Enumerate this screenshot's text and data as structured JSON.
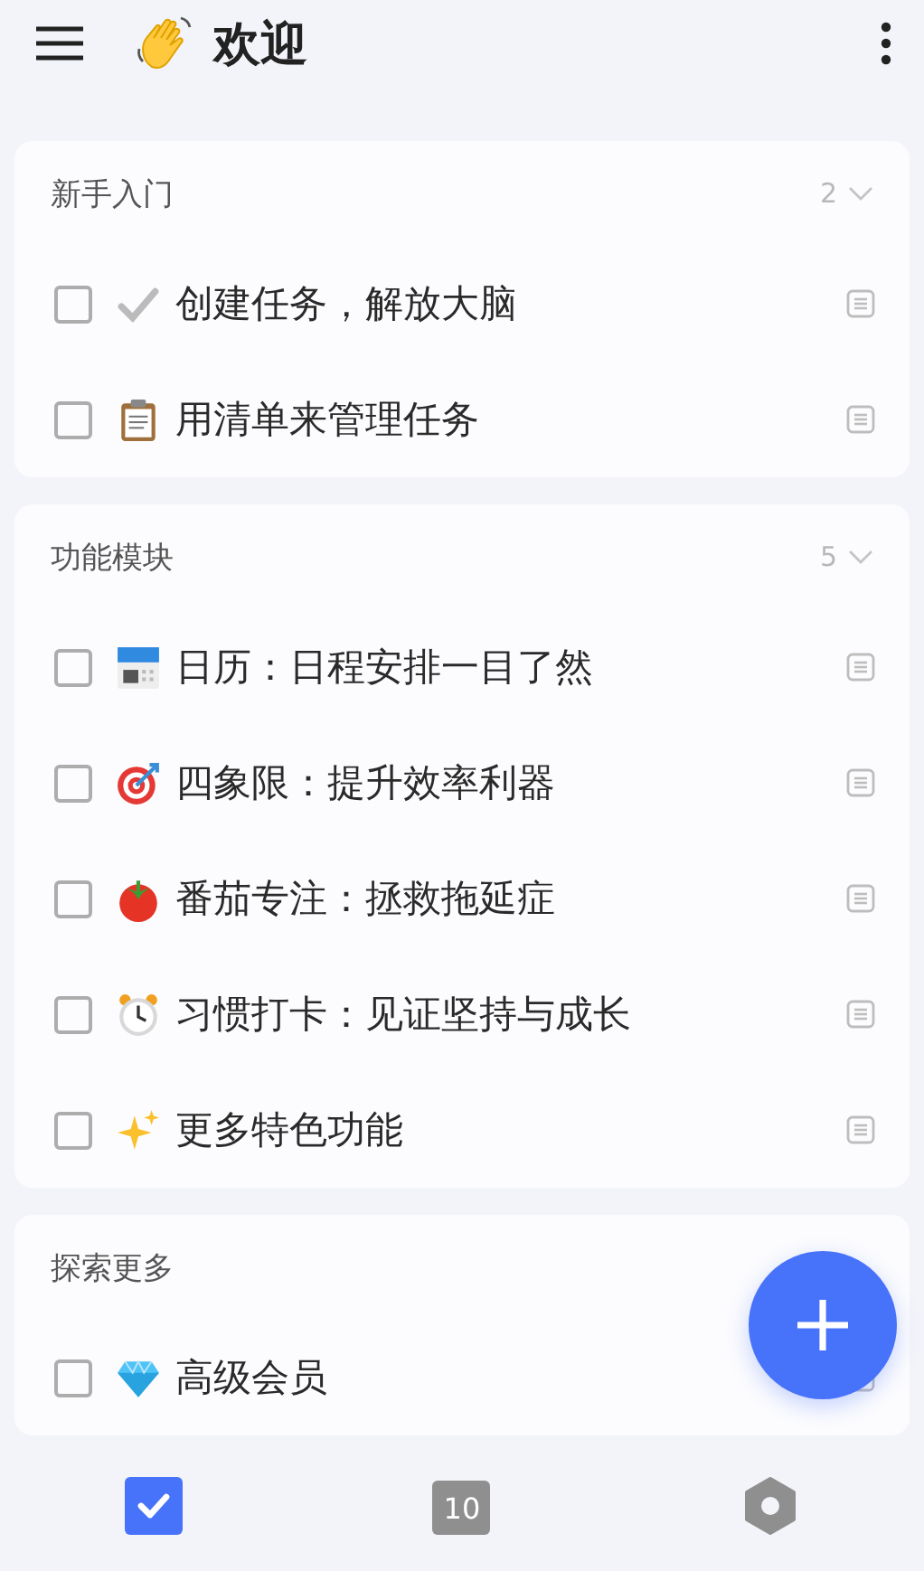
{
  "header": {
    "title": "欢迎"
  },
  "sections": [
    {
      "title": "新手入门",
      "count": "2",
      "expanded": true,
      "tasks": [
        {
          "title": "创建任务，解放大脑",
          "checked": false
        },
        {
          "title": "用清单来管理任务",
          "checked": false
        }
      ]
    },
    {
      "title": "功能模块",
      "count": "5",
      "expanded": true,
      "tasks": [
        {
          "title": "日历：日程安排一目了然",
          "checked": false
        },
        {
          "title": "四象限：提升效率利器",
          "checked": false
        },
        {
          "title": "番茄专注：拯救拖延症",
          "checked": false
        },
        {
          "title": "习惯打卡：见证坚持与成长",
          "checked": false
        },
        {
          "title": "更多特色功能",
          "checked": false
        }
      ]
    },
    {
      "title": "探索更多",
      "tasks": [
        {
          "title": "高级会员",
          "checked": false
        }
      ]
    }
  ],
  "bottom_nav": [
    {
      "kind": "tasks",
      "selected": true
    },
    {
      "kind": "calendar",
      "label": "10",
      "selected": false
    },
    {
      "kind": "settings",
      "selected": false
    }
  ]
}
